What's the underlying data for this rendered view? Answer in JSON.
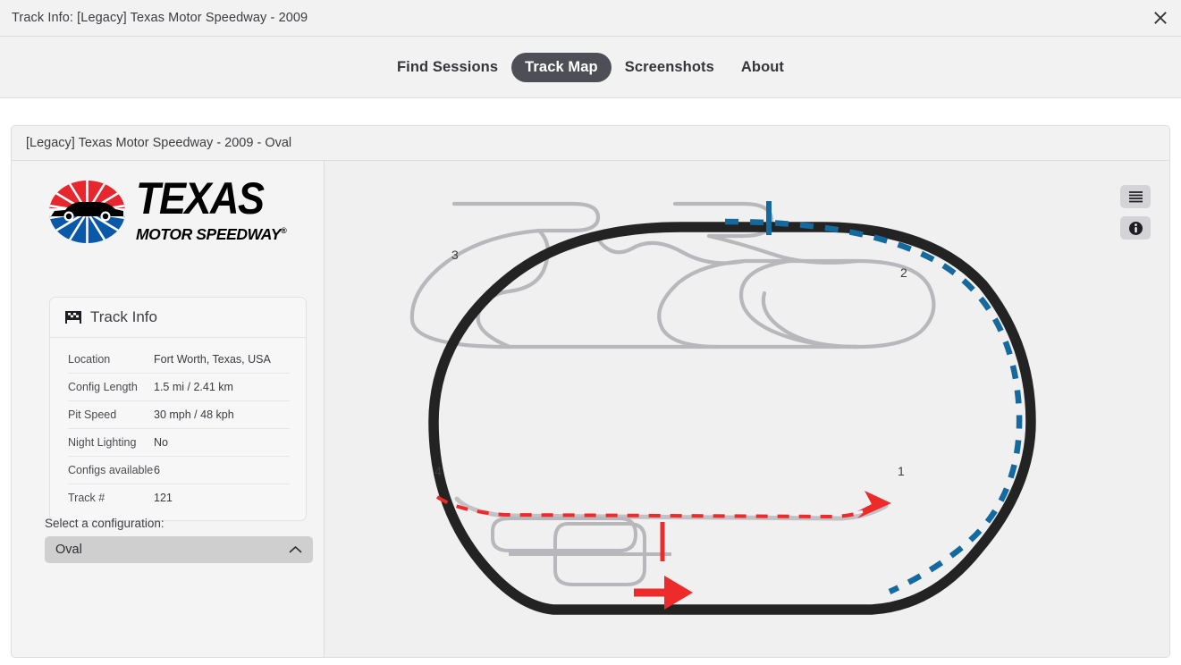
{
  "window": {
    "title": "Track Info: [Legacy] Texas Motor Speedway - 2009",
    "close_icon": "close-icon"
  },
  "nav": {
    "items": [
      {
        "label": "Find Sessions",
        "active": false
      },
      {
        "label": "Track Map",
        "active": true
      },
      {
        "label": "Screenshots",
        "active": false
      },
      {
        "label": "About",
        "active": false
      }
    ],
    "active_color": "#4e4e56"
  },
  "card": {
    "header": "[Legacy] Texas Motor Speedway - 2009 - Oval"
  },
  "sidebar": {
    "logo": {
      "name": "texas-motor-speedway-logo",
      "primary_text": "TEXAS",
      "secondary_text": "MOTOR SPEEDWAY",
      "registered_mark": "®",
      "red": "#e8262d",
      "blue": "#0a58a8"
    },
    "info_panel": {
      "icon": "checkered-flag-icon",
      "title": "Track Info",
      "rows": [
        {
          "key": "Location",
          "value": "Fort Worth, Texas, USA"
        },
        {
          "key": "Config Length",
          "value": "1.5 mi / 2.41 km"
        },
        {
          "key": "Pit Speed",
          "value": "30 mph / 48 kph"
        },
        {
          "key": "Night Lighting",
          "value": "No"
        },
        {
          "key": "Configs available",
          "value": "6"
        },
        {
          "key": "Track #",
          "value": "121"
        }
      ]
    },
    "config_select": {
      "label": "Select a configuration:",
      "value": "Oval",
      "chevron": "chevron-up-icon"
    }
  },
  "map": {
    "turn_labels": [
      "1",
      "2",
      "3",
      "4"
    ],
    "colors": {
      "track": "#232323",
      "infield": "#b8b8bc",
      "racing_line": "#14699e",
      "pit_lane": "#ee2b2b"
    },
    "buttons": [
      {
        "name": "layers-button",
        "icon": "hamburger-icon"
      },
      {
        "name": "info-button",
        "icon": "info-icon"
      }
    ],
    "start_finish": "start-finish-line",
    "direction": "clockwise"
  }
}
